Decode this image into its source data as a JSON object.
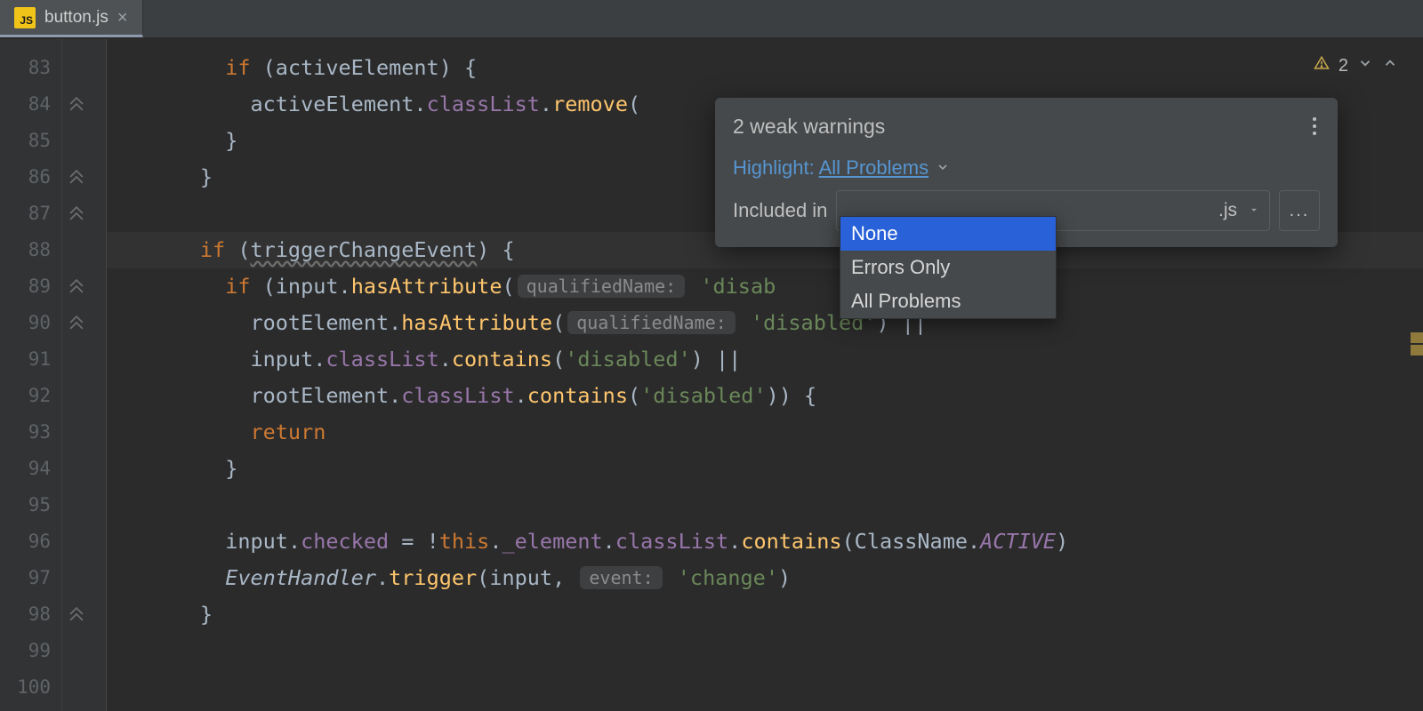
{
  "tab": {
    "file_name": "button.js",
    "ext_badge": "JS"
  },
  "problems_widget": {
    "count": "2"
  },
  "gutter": {
    "start": 83,
    "end": 100
  },
  "popup": {
    "title": "2 weak warnings",
    "highlight_label": "Highlight:",
    "highlight_value": "All Problems",
    "included_label_left": "Included in",
    "file_suffix": ".js",
    "more_button": "...",
    "dropdown_options": [
      "None",
      "Errors Only",
      "All Problems"
    ],
    "dropdown_selected_index": 0
  },
  "code": {
    "lines": [
      {
        "n": 83,
        "tokens": [
          [
            "ind",
            4
          ],
          [
            "kw",
            "if"
          ],
          [
            "op",
            " ("
          ],
          [
            "id",
            "activeElement"
          ],
          [
            "op",
            ") {"
          ]
        ]
      },
      {
        "n": 84,
        "tokens": [
          [
            "ind",
            5
          ],
          [
            "id",
            "activeElement"
          ],
          [
            "op",
            "."
          ],
          [
            "prop",
            "classList"
          ],
          [
            "op",
            "."
          ],
          [
            "mth",
            "remove"
          ],
          [
            "op",
            "("
          ]
        ]
      },
      {
        "n": 85,
        "tokens": [
          [
            "ind",
            4
          ],
          [
            "op",
            "}"
          ]
        ]
      },
      {
        "n": 86,
        "tokens": [
          [
            "ind",
            3
          ],
          [
            "op",
            "}"
          ]
        ]
      },
      {
        "n": 87,
        "tokens": []
      },
      {
        "n": 88,
        "hl": true,
        "tokens": [
          [
            "ind",
            3
          ],
          [
            "kw",
            "if"
          ],
          [
            "op",
            " ("
          ],
          [
            "squiggle",
            "triggerChangeEvent"
          ],
          [
            "op",
            ") {"
          ]
        ]
      },
      {
        "n": 89,
        "tokens": [
          [
            "ind",
            4
          ],
          [
            "kw",
            "if"
          ],
          [
            "op",
            " ("
          ],
          [
            "id",
            "input"
          ],
          [
            "op",
            "."
          ],
          [
            "mth",
            "hasAttribute"
          ],
          [
            "op",
            "("
          ],
          [
            "hint",
            "qualifiedName:"
          ],
          [
            "str",
            "'disab"
          ]
        ]
      },
      {
        "n": 90,
        "tokens": [
          [
            "ind",
            5
          ],
          [
            "id",
            "rootElement"
          ],
          [
            "op",
            "."
          ],
          [
            "mth",
            "hasAttribute"
          ],
          [
            "op",
            "("
          ],
          [
            "hint",
            "qualifiedName:"
          ],
          [
            "str",
            "'disabled'"
          ],
          [
            "op",
            ") ||"
          ]
        ]
      },
      {
        "n": 91,
        "tokens": [
          [
            "ind",
            5
          ],
          [
            "id",
            "input"
          ],
          [
            "op",
            "."
          ],
          [
            "prop",
            "classList"
          ],
          [
            "op",
            "."
          ],
          [
            "mth",
            "contains"
          ],
          [
            "op",
            "("
          ],
          [
            "str",
            "'disabled'"
          ],
          [
            "op",
            ") ||"
          ]
        ]
      },
      {
        "n": 92,
        "tokens": [
          [
            "ind",
            5
          ],
          [
            "id",
            "rootElement"
          ],
          [
            "op",
            "."
          ],
          [
            "prop",
            "classList"
          ],
          [
            "op",
            "."
          ],
          [
            "mth",
            "contains"
          ],
          [
            "op",
            "("
          ],
          [
            "str",
            "'disabled'"
          ],
          [
            "op",
            ")) {"
          ]
        ]
      },
      {
        "n": 93,
        "tokens": [
          [
            "ind",
            5
          ],
          [
            "kw",
            "return"
          ]
        ]
      },
      {
        "n": 94,
        "tokens": [
          [
            "ind",
            4
          ],
          [
            "op",
            "}"
          ]
        ]
      },
      {
        "n": 95,
        "tokens": []
      },
      {
        "n": 96,
        "tokens": [
          [
            "ind",
            4
          ],
          [
            "id",
            "input"
          ],
          [
            "op",
            "."
          ],
          [
            "prop",
            "checked"
          ],
          [
            "op",
            " = !"
          ],
          [
            "kw",
            "this"
          ],
          [
            "op",
            "."
          ],
          [
            "prop",
            "_element"
          ],
          [
            "op",
            "."
          ],
          [
            "prop",
            "classList"
          ],
          [
            "op",
            "."
          ],
          [
            "mth",
            "contains"
          ],
          [
            "op",
            "("
          ],
          [
            "id",
            "ClassName"
          ],
          [
            "op",
            "."
          ],
          [
            "cls2",
            "ACTIVE"
          ],
          [
            "op",
            ")"
          ]
        ]
      },
      {
        "n": 97,
        "tokens": [
          [
            "ind",
            4
          ],
          [
            "cls",
            "EventHandler"
          ],
          [
            "op",
            "."
          ],
          [
            "mth",
            "trigger"
          ],
          [
            "op",
            "("
          ],
          [
            "id",
            "input"
          ],
          [
            "op",
            ", "
          ],
          [
            "hint",
            "event:"
          ],
          [
            "str",
            "'change'"
          ],
          [
            "op",
            ")"
          ]
        ]
      },
      {
        "n": 98,
        "tokens": [
          [
            "ind",
            3
          ],
          [
            "op",
            "}"
          ]
        ]
      },
      {
        "n": 99,
        "tokens": []
      }
    ]
  },
  "fold_marks": [
    84,
    86,
    87,
    89,
    90,
    98
  ]
}
